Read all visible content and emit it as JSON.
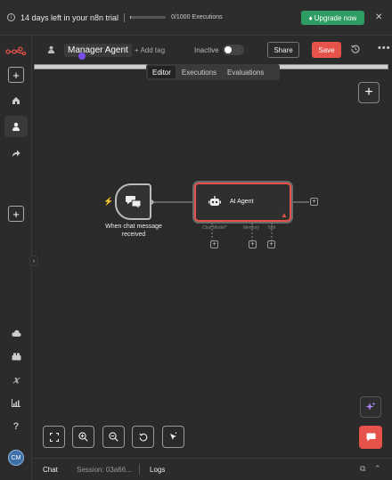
{
  "banner": {
    "trial_text": "14 days left in your n8n trial",
    "executions": "0/1000 Executions",
    "executions_used_fraction": 0.0,
    "upgrade_label": "Upgrade now",
    "close": "✕"
  },
  "sidebar": {
    "add": "+",
    "bottom_add": "+",
    "avatar_initials": "CM"
  },
  "header": {
    "workflow_name": "Manager Agent",
    "add_tag": "+ Add tag",
    "status": "Inactive",
    "share": "Share",
    "save": "Save",
    "more": "•••"
  },
  "tabs": [
    "Editor",
    "Executions",
    "Evaluations"
  ],
  "canvas": {
    "add": "+",
    "trigger": {
      "label": "When chat message received"
    },
    "agent": {
      "title": "AI Agent",
      "subnodes": [
        "Chat Model*",
        "Memory",
        "Tool"
      ]
    }
  },
  "bottom": {
    "chat": "Chat",
    "session": "Session: 03a66...",
    "logs": "Logs"
  },
  "colors": {
    "accent": "#e5534b",
    "upgrade": "#2e9d63",
    "background": "#2a2a2a"
  }
}
